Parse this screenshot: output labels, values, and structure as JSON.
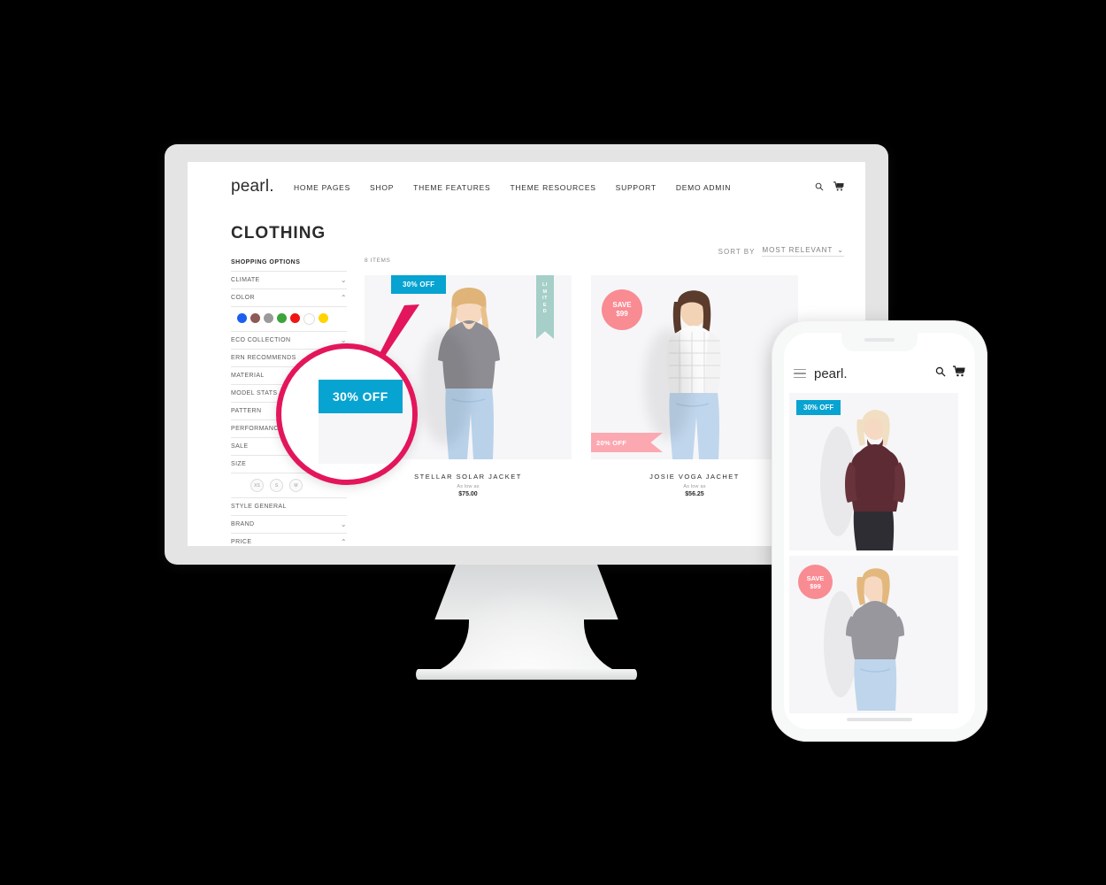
{
  "brand": {
    "logo": "pearl.",
    "accent_cyan": "#07a3d1",
    "accent_pink": "#f98b93",
    "accent_crimson": "#e3165b",
    "accent_teal": "#a5cfc8"
  },
  "desktop": {
    "nav": {
      "logo": "pearl.",
      "items": [
        {
          "label": "HOME PAGES"
        },
        {
          "label": "SHOP"
        },
        {
          "label": "THEME FEATURES"
        },
        {
          "label": "THEME RESOURCES"
        },
        {
          "label": "SUPPORT"
        },
        {
          "label": "DEMO ADMIN"
        }
      ],
      "search_icon": "search-icon",
      "cart_icon": "cart-icon"
    },
    "page_title": "CLOTHING",
    "sidebar": {
      "heading": "SHOPPING OPTIONS",
      "filters": [
        {
          "label": "CLIMATE",
          "state": "collapsed",
          "chevron": "⌄"
        },
        {
          "label": "COLOR",
          "state": "expanded",
          "chevron": "⌃"
        },
        {
          "label": "ECO COLLECTION",
          "state": "collapsed",
          "chevron": "⌄"
        },
        {
          "label": "ERN RECOMMENDS",
          "state": "collapsed",
          "chevron": ""
        },
        {
          "label": "MATERIAL",
          "state": "collapsed",
          "chevron": ""
        },
        {
          "label": "MODEL STATS",
          "state": "collapsed",
          "chevron": ""
        },
        {
          "label": "PATTERN",
          "state": "collapsed",
          "chevron": ""
        },
        {
          "label": "PERFORMANCE",
          "state": "collapsed",
          "chevron": ""
        },
        {
          "label": "SALE",
          "state": "collapsed",
          "chevron": ""
        },
        {
          "label": "SIZE",
          "state": "expanded",
          "chevron": ""
        },
        {
          "label": "STYLE GENERAL",
          "state": "collapsed",
          "chevron": ""
        },
        {
          "label": "BRAND",
          "state": "collapsed",
          "chevron": "⌄"
        },
        {
          "label": "PRICE",
          "state": "expanded",
          "chevron": "⌃"
        }
      ],
      "colors": [
        {
          "name": "blue",
          "hex": "#1b5ff0"
        },
        {
          "name": "brown",
          "hex": "#8d5a55"
        },
        {
          "name": "gray",
          "hex": "#9a9a9a"
        },
        {
          "name": "green",
          "hex": "#3aa53a"
        },
        {
          "name": "red",
          "hex": "#f01515"
        },
        {
          "name": "white",
          "hex": "#ffffff"
        },
        {
          "name": "yellow",
          "hex": "#ffd400"
        }
      ],
      "sizes": [
        {
          "label": "XS"
        },
        {
          "label": "S"
        },
        {
          "label": "M"
        }
      ]
    },
    "toolbar": {
      "items_count": "8 ITEMS",
      "sort_label": "SORT BY",
      "sort_value": "MOST RELEVANT",
      "sort_chevron": "⌄"
    },
    "products": [
      {
        "name": "STELLAR SOLAR JACKET",
        "as_low_as": "As low as",
        "price": "$75.00",
        "badge": "30% OFF",
        "badge_type": "discount-cyan",
        "ribbon": "LIMITED",
        "ribbon_type": "limited-vertical"
      },
      {
        "name": "JOSIE VOGA JACHET",
        "as_low_as": "As low as",
        "price": "$56.25",
        "badge_save_line1": "SAVE",
        "badge_save_line2": "$99",
        "ribbon": "20% OFF",
        "ribbon_type": "discount-pink"
      }
    ]
  },
  "magnifier": {
    "badge": "30% OFF",
    "ring_color": "#e3165b"
  },
  "mobile": {
    "nav": {
      "menu_icon": "hamburger-icon",
      "logo": "pearl.",
      "search_icon": "search-icon",
      "cart_icon": "cart-icon"
    },
    "cards": [
      {
        "badge": "30% OFF",
        "badge_type": "discount-cyan"
      },
      {
        "badge_save_line1": "SAVE",
        "badge_save_line2": "$99",
        "badge_type": "save-circle"
      }
    ]
  }
}
